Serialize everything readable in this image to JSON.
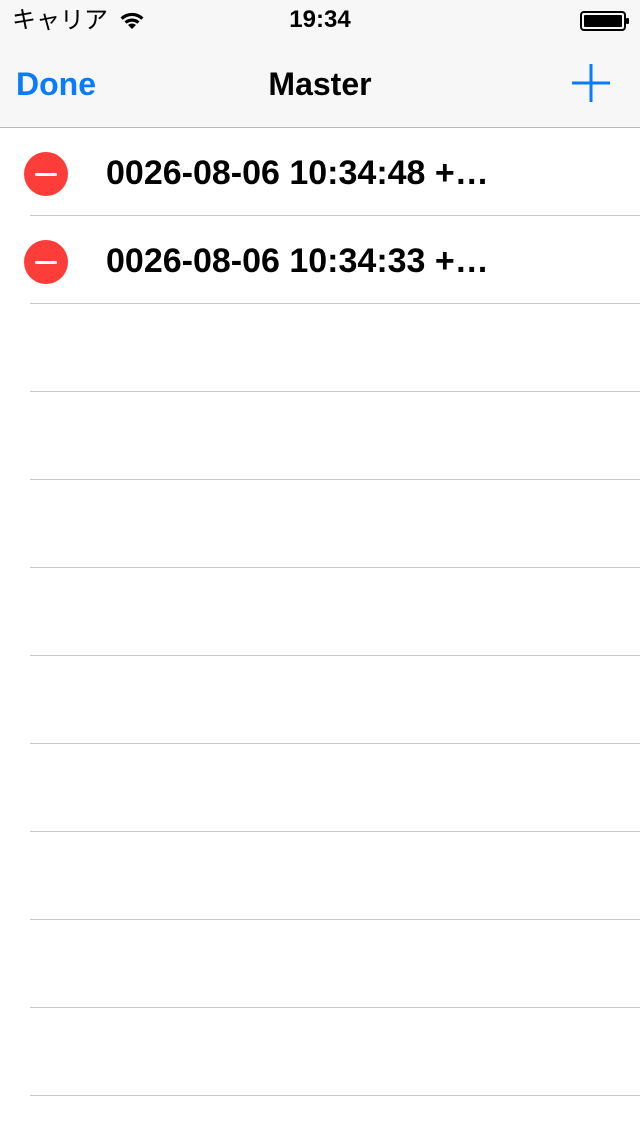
{
  "status_bar": {
    "carrier": "キャリア",
    "time": "19:34",
    "wifi_icon": "wifi-icon",
    "battery_icon": "battery-full-icon"
  },
  "nav_bar": {
    "done_label": "Done",
    "title": "Master",
    "add_icon": "plus-icon",
    "accent_color": "#0a7aff"
  },
  "table": {
    "rows": [
      {
        "label": "0026-08-06 10:34:48 +…",
        "delete_icon": "minus-circle-icon"
      },
      {
        "label": "0026-08-06 10:34:33 +…",
        "delete_icon": "minus-circle-icon"
      }
    ],
    "empty_row_count": 10,
    "delete_color": "#fc3d39"
  }
}
